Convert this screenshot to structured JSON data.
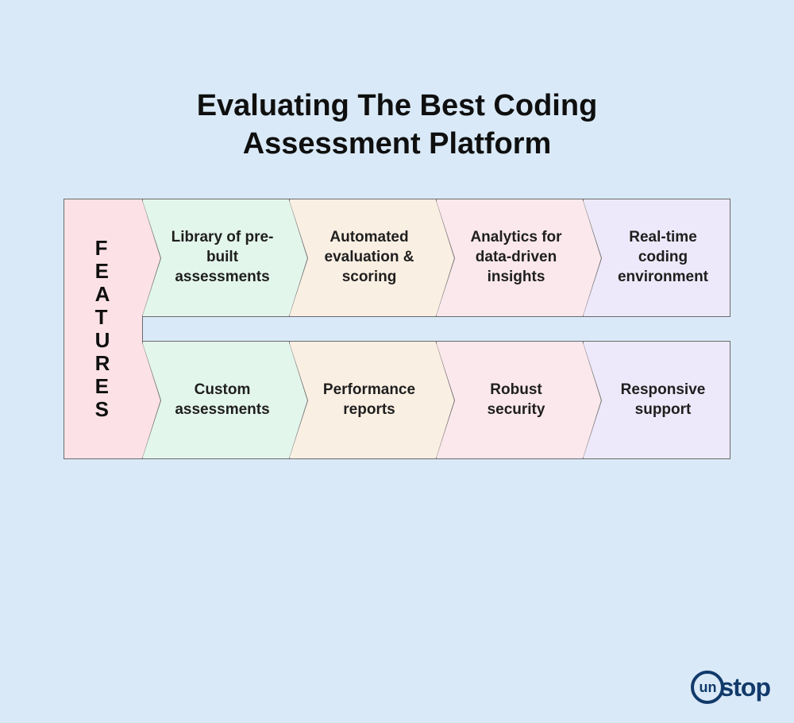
{
  "title_line1": "Evaluating The Best Coding",
  "title_line2": "Assessment Platform",
  "features_label": "FEATURES",
  "row1": {
    "c1": "Library of pre-built assessments",
    "c2": "Automated evaluation & scoring",
    "c3": "Analytics for data-driven insights",
    "c4": "Real-time coding environment"
  },
  "row2": {
    "c1": "Custom assessments",
    "c2": "Performance reports",
    "c3": "Robust security",
    "c4": "Responsive support"
  },
  "logo": {
    "prefix": "un",
    "suffix": "stop"
  }
}
